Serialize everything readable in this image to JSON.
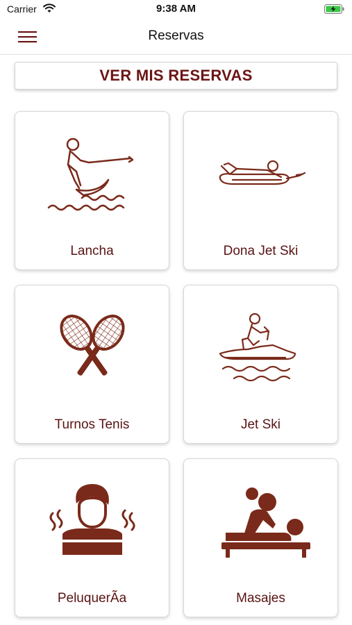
{
  "status_bar": {
    "carrier": "Carrier",
    "time": "9:38 AM",
    "icons": [
      "wifi-icon",
      "battery-charging-icon"
    ]
  },
  "nav": {
    "title": "Reservas",
    "menu_icon": "hamburger-menu-icon"
  },
  "my_bookings_button": "VER MIS RESERVAS",
  "services": [
    {
      "label": "Lancha",
      "icon": "waterski-icon"
    },
    {
      "label": "Dona Jet Ski",
      "icon": "towable-tube-icon"
    },
    {
      "label": "Turnos Tenis",
      "icon": "tennis-rackets-icon"
    },
    {
      "label": "Jet Ski",
      "icon": "jet-ski-icon"
    },
    {
      "label": "PeluquerÃa",
      "icon": "hairdresser-icon"
    },
    {
      "label": "Masajes",
      "icon": "massage-icon"
    }
  ],
  "colors": {
    "accent": "#6b1515",
    "icon": "#7a2a1a",
    "label": "#5a1313",
    "divider": "#e2e2e2",
    "battery_green": "#3cc84a"
  }
}
